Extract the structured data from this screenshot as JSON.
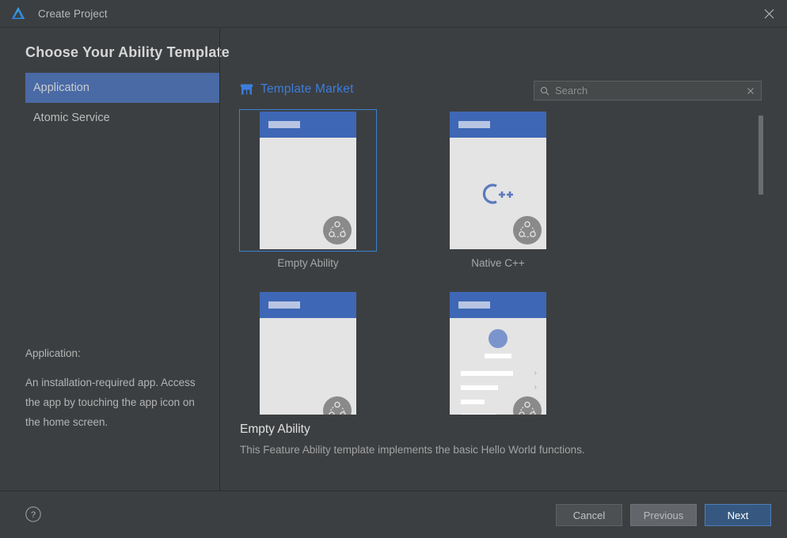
{
  "window": {
    "title": "Create Project",
    "logo_icon": "huawei-devEco-logo-icon",
    "close_icon": "close-icon"
  },
  "heading": "Choose Your Ability Template",
  "sidebar": {
    "items": [
      {
        "label": "Application",
        "selected": true
      },
      {
        "label": "Atomic Service",
        "selected": false
      }
    ],
    "description": {
      "title": "Application:",
      "body": "An installation-required app. Access the app by touching the app icon on the home screen."
    }
  },
  "content": {
    "market_link": {
      "label": "Template Market",
      "icon": "store-icon",
      "color": "#3b7ddd"
    },
    "search": {
      "placeholder": "Search",
      "value": "",
      "icon": "search-icon",
      "clear_icon": "clear-icon"
    },
    "templates": [
      {
        "label": "Empty Ability",
        "selected": true,
        "kind": "blank"
      },
      {
        "label": "Native C++",
        "selected": false,
        "kind": "cpp"
      },
      {
        "label": "",
        "selected": false,
        "kind": "blank"
      },
      {
        "label": "",
        "selected": false,
        "kind": "settings"
      }
    ],
    "selected_description": {
      "title": "Empty Ability",
      "body": "This Feature Ability template implements the basic Hello World functions."
    },
    "scrollbar": {
      "position": "top"
    }
  },
  "footer": {
    "help_icon": "help-icon",
    "buttons": [
      {
        "label": "Cancel",
        "style": "default"
      },
      {
        "label": "Previous",
        "style": "hover"
      },
      {
        "label": "Next",
        "style": "primary"
      }
    ]
  },
  "colors": {
    "window_bg": "#3c3f41",
    "accent_blue": "#3b82d4",
    "selection_blue": "#4a6aa5",
    "primary_button": "#365880",
    "link_blue": "#3b7ddd"
  }
}
